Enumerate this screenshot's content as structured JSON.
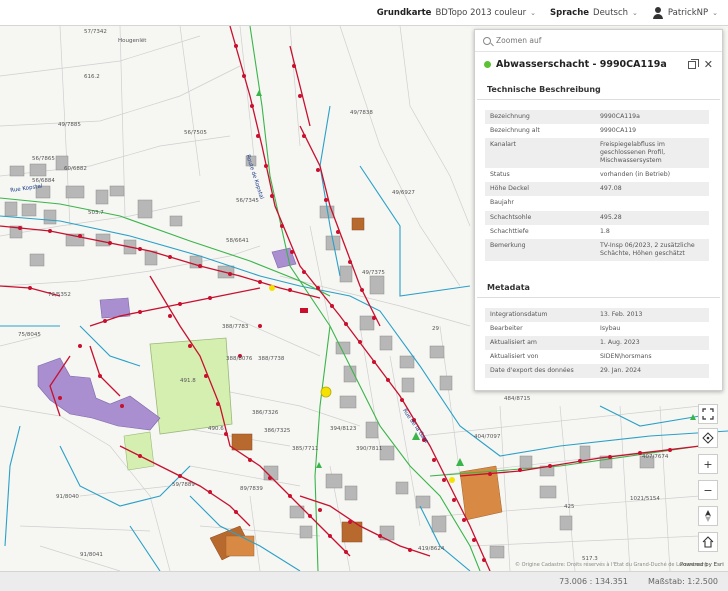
{
  "topbar": {
    "basemap_label": "Grundkarte",
    "basemap_value": "BDTopo 2013 couleur",
    "language_label": "Sprache",
    "language_value": "Deutsch",
    "user_name": "PatrickNP"
  },
  "panel": {
    "search_placeholder": "Zoomen auf",
    "title": "Abwasserschacht - 9990CA119a",
    "section_technical": "Technische Beschreibung",
    "technical_rows": [
      {
        "label": "Bezeichnung",
        "value": "9990CA119a"
      },
      {
        "label": "Bezeichnung alt",
        "value": "9990CA119"
      },
      {
        "label": "Kanalart",
        "value": "Freispiegelabfluss im geschlossenen Profil, Mischwassersystem"
      },
      {
        "label": "Status",
        "value": "vorhanden (in Betrieb)"
      },
      {
        "label": "Höhe Deckel",
        "value": "497.08"
      },
      {
        "label": "Baujahr",
        "value": ""
      },
      {
        "label": "Schachtsohle",
        "value": "495.28"
      },
      {
        "label": "Schachttiefe",
        "value": "1.8"
      },
      {
        "label": "Bemerkung",
        "value": "TV-Insp 06/2023, 2 zusätzliche Schächte, Höhen geschätzt"
      }
    ],
    "section_metadata": "Metadata",
    "metadata_rows": [
      {
        "label": "Integrationsdatum",
        "value": "13. Feb. 2013"
      },
      {
        "label": "Bearbeiter",
        "value": "Isybau"
      },
      {
        "label": "Aktualisiert am",
        "value": "1. Aug. 2023"
      },
      {
        "label": "Aktualisiert von",
        "value": "SIDEN\\horsmans"
      },
      {
        "label": "Date d'export des données",
        "value": "29. Jan. 2024"
      }
    ]
  },
  "map": {
    "parcel_labels": [
      {
        "text": "57/7342"
      },
      {
        "text": "Hougenlët"
      },
      {
        "text": "616.2"
      },
      {
        "text": "49/7885"
      },
      {
        "text": "56/7865"
      },
      {
        "text": "60/6882"
      },
      {
        "text": "56/6884"
      },
      {
        "text": "56/7505"
      },
      {
        "text": "49/7838"
      },
      {
        "text": "56/7345"
      },
      {
        "text": "49/6927"
      },
      {
        "text": "503.7"
      },
      {
        "text": "58/6641"
      },
      {
        "text": "49/7375"
      },
      {
        "text": "72/5352"
      },
      {
        "text": "75/8045"
      },
      {
        "text": "388/7783"
      },
      {
        "text": "388/8076"
      },
      {
        "text": "388/7738"
      },
      {
        "text": "491.8"
      },
      {
        "text": "386/7326"
      },
      {
        "text": "386/7325"
      },
      {
        "text": "394/8123"
      },
      {
        "text": "385/7711"
      },
      {
        "text": "390/7811"
      },
      {
        "text": "89/7839"
      },
      {
        "text": "91/8040"
      },
      {
        "text": "91/8041"
      },
      {
        "text": "29"
      },
      {
        "text": "404/7097"
      },
      {
        "text": "407/7674"
      },
      {
        "text": "1021/5154"
      },
      {
        "text": "425"
      },
      {
        "text": "419/8624"
      },
      {
        "text": "517.3"
      },
      {
        "text": "484/8715"
      },
      {
        "text": "59/7889"
      },
      {
        "text": "490.6"
      }
    ],
    "street_labels": [
      {
        "text": "Route de Kopstal"
      },
      {
        "text": "Rue Kopstal"
      },
      {
        "text": "Rue de la Gare"
      }
    ]
  },
  "controls": {
    "zoom_in": "+",
    "zoom_out": "−"
  },
  "bottom": {
    "coordinates": "73.006 : 134.351",
    "scale": "Maßstab: 1:2.500",
    "attribution": "© Origine Cadastre: Droits réservés à l'Etat du Grand-Duché de Luxembourg",
    "powered": "Powered by Esri"
  },
  "colors": {
    "sewer": "#c8102e",
    "water": "#2aa0c8",
    "gas": "#3ab54a",
    "building": "#b7b7b7",
    "school": "#a98ed0",
    "sports": "#d5efb0",
    "status_dot": "#5cc233"
  }
}
